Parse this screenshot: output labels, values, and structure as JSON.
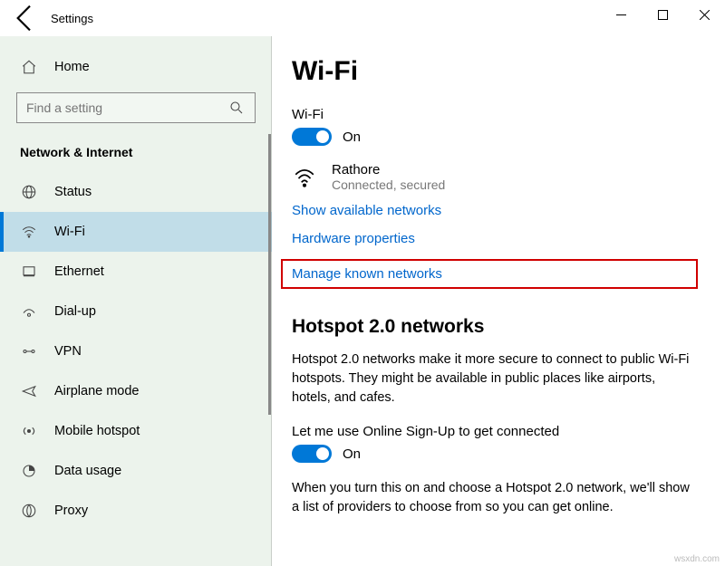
{
  "window": {
    "title": "Settings"
  },
  "sidebar": {
    "home": "Home",
    "search_placeholder": "Find a setting",
    "category": "Network & Internet",
    "items": [
      {
        "label": "Status"
      },
      {
        "label": "Wi-Fi"
      },
      {
        "label": "Ethernet"
      },
      {
        "label": "Dial-up"
      },
      {
        "label": "VPN"
      },
      {
        "label": "Airplane mode"
      },
      {
        "label": "Mobile hotspot"
      },
      {
        "label": "Data usage"
      },
      {
        "label": "Proxy"
      }
    ]
  },
  "content": {
    "heading": "Wi-Fi",
    "wifi_label": "Wi-Fi",
    "wifi_toggle_state": "On",
    "network": {
      "name": "Rathore",
      "status": "Connected, secured"
    },
    "links": {
      "show_available": "Show available networks",
      "hardware_props": "Hardware properties",
      "manage_known": "Manage known networks"
    },
    "hotspot": {
      "heading": "Hotspot 2.0 networks",
      "desc": "Hotspot 2.0 networks make it more secure to connect to public Wi-Fi hotspots. They might be available in public places like airports, hotels, and cafes.",
      "signup_label": "Let me use Online Sign-Up to get connected",
      "signup_state": "On",
      "signup_desc": "When you turn this on and choose a Hotspot 2.0 network, we'll show a list of providers to choose from so you can get online."
    }
  },
  "watermark": "wsxdn.com"
}
